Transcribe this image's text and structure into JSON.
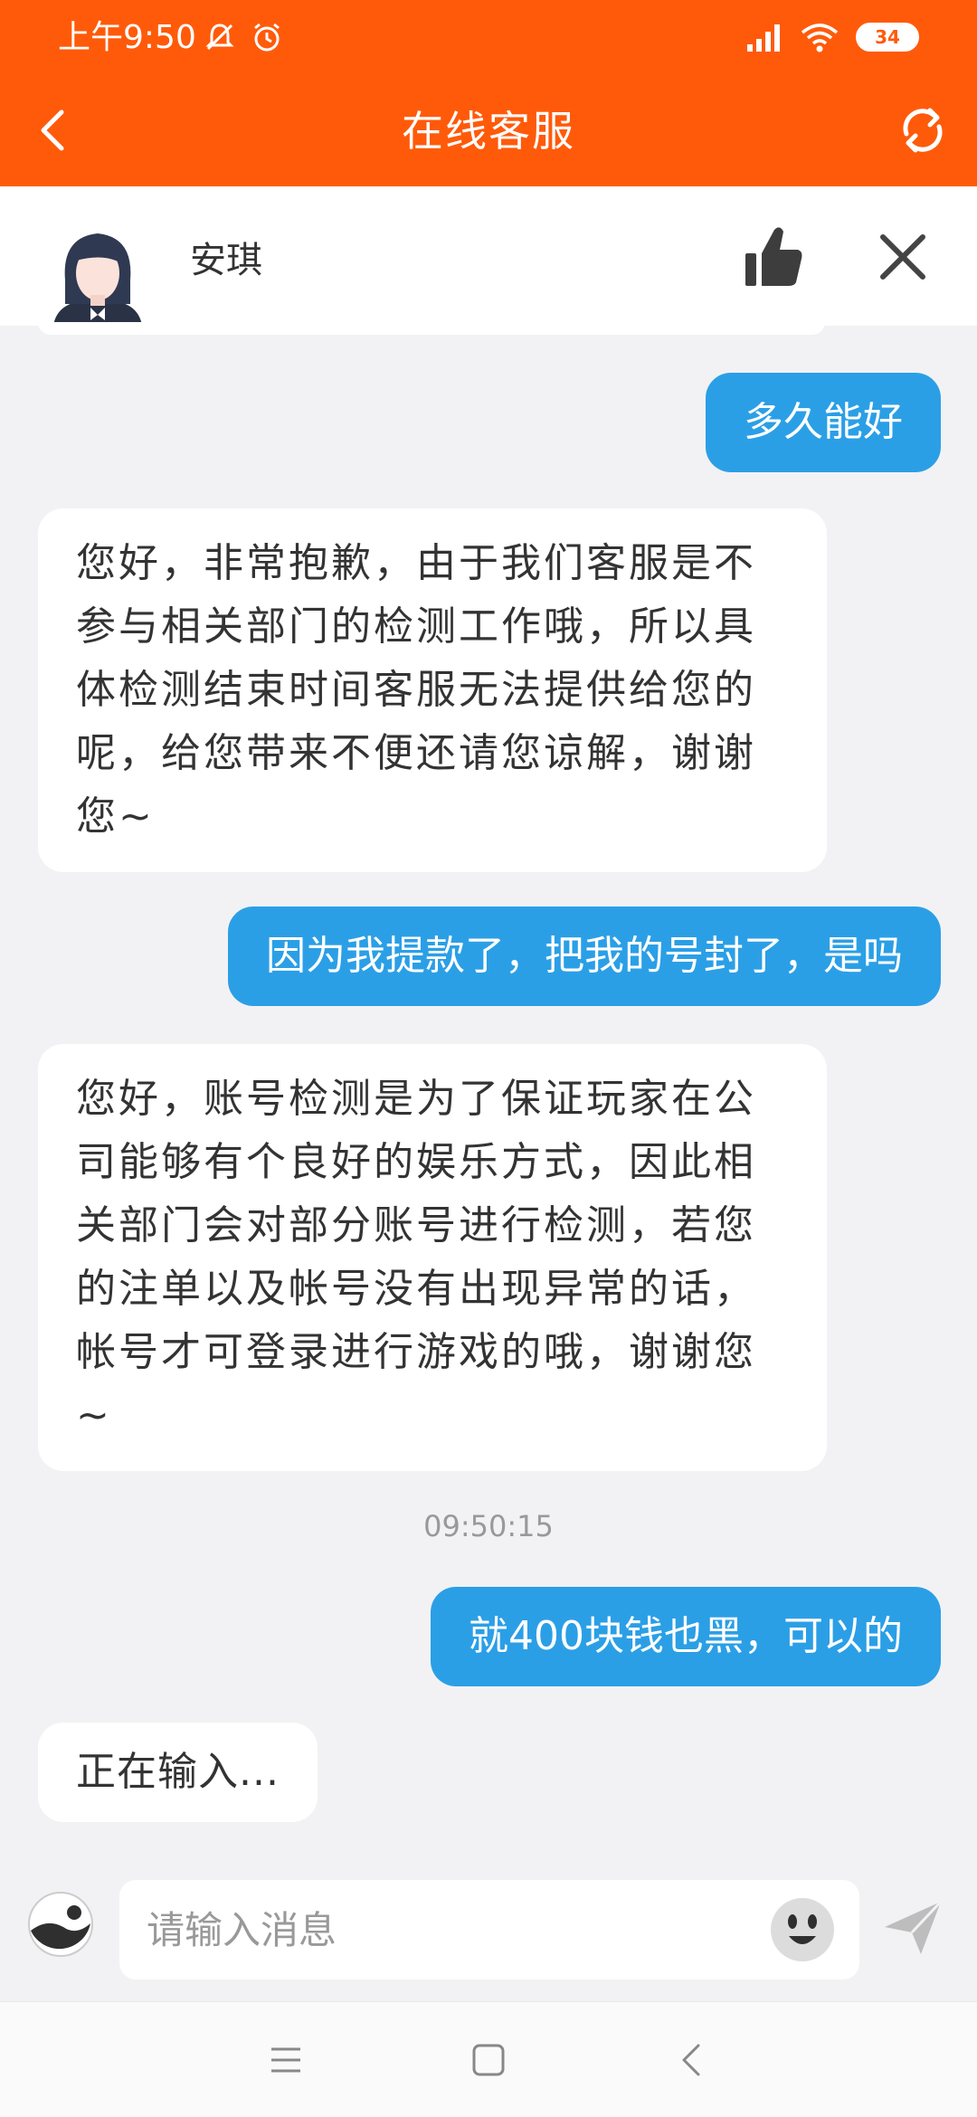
{
  "status_bar": {
    "time": "上午9:50",
    "battery": "34",
    "icons": [
      "mute-icon",
      "alarm-icon",
      "signal-icon",
      "wifi-icon",
      "battery-icon"
    ]
  },
  "header": {
    "title": "在线客服",
    "back_icon": "back-arrow-icon",
    "refresh_icon": "refresh-icon",
    "background": "#ff5a0a"
  },
  "agent": {
    "name": "安琪",
    "avatar": "agent-avatar",
    "like_icon": "thumbs-up-icon",
    "close_icon": "close-icon"
  },
  "messages": [
    {
      "side": "out",
      "text": "多久能好"
    },
    {
      "side": "in",
      "text": "您好，非常抱歉，由于我们客服是不参与相关部门的检测工作哦，所以具体检测结束时间客服无法提供给您的呢，给您带来不便还请您谅解，谢谢您~"
    },
    {
      "side": "out",
      "text": "因为我提款了，把我的号封了，是吗"
    },
    {
      "side": "in",
      "text": "您好，账号检测是为了保证玩家在公司能够有个良好的娱乐方式，因此相关部门会对部分账号进行检测，若您的注单以及帐号没有出现异常的话，帐号才可登录进行游戏的哦，谢谢您~"
    },
    {
      "side": "time",
      "text": "09:50:15"
    },
    {
      "side": "out",
      "text": "就400块钱也黑，可以的"
    },
    {
      "side": "in",
      "text": "正在输入..."
    }
  ],
  "composer": {
    "placeholder": "请输入消息",
    "value": "",
    "media_icon": "image-icon",
    "emoji_icon": "emoji-icon",
    "send_icon": "send-icon"
  },
  "colors": {
    "accent": "#ff5a0a",
    "outgoing_bubble": "#2b9fe6",
    "incoming_bubble": "#ffffff",
    "background": "#f2f2f4"
  },
  "nav": {
    "icons": [
      "menu-icon",
      "home-icon",
      "back-icon"
    ]
  }
}
